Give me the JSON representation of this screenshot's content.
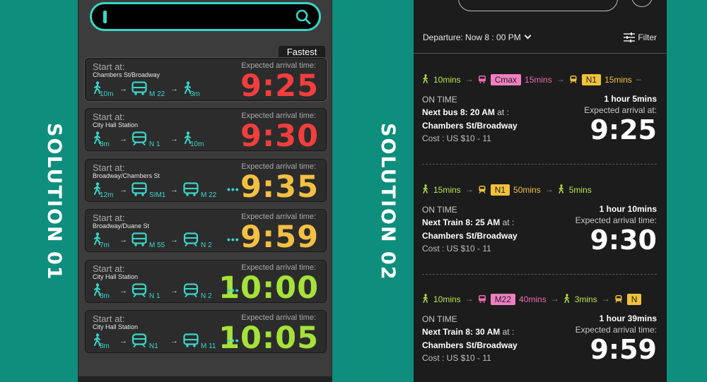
{
  "labels": {
    "solution1": "SOLUTION 01",
    "solution2": "SOLUTION 02"
  },
  "colors": {
    "background": "#0e8e7c",
    "accent": "#3ad6c8",
    "red": "#f23e3e",
    "yellow": "#f4c043",
    "green": "#a6e23a",
    "pink": "#f27ec2",
    "tag_yellow": "#f2c23a"
  },
  "solution1": {
    "search": {
      "icon": "search-icon"
    },
    "fastest_label": "Fastest",
    "cards": [
      {
        "start_label": "Start at:",
        "location": "Chambers St/Broadway",
        "expected_label": "Expected arrival time:",
        "time": "9:25",
        "color": "#f23e3e",
        "route": [
          {
            "type": "walk",
            "label": "10m"
          },
          {
            "type": "bus",
            "label": "M 22"
          },
          {
            "type": "walk",
            "label": "3m"
          }
        ],
        "more": ""
      },
      {
        "start_label": "Start at:",
        "location": "City Hall Station",
        "expected_label": "Expected arrival time:",
        "time": "9:30",
        "color": "#f23e3e",
        "route": [
          {
            "type": "walk",
            "label": "8m"
          },
          {
            "type": "train",
            "label": "N 1"
          },
          {
            "type": "walk",
            "label": "10m"
          }
        ],
        "more": ""
      },
      {
        "start_label": "Start at:",
        "location": "Broadway/Chambers St",
        "expected_label": "Expected arrival time:",
        "time": "9:35",
        "color": "#f4c043",
        "route": [
          {
            "type": "walk",
            "label": "12m"
          },
          {
            "type": "bus",
            "label": "SIM1"
          },
          {
            "type": "bus",
            "label": "M 22"
          }
        ],
        "more": "•••"
      },
      {
        "start_label": "Start at:",
        "location": "Broadway/Duane St",
        "expected_label": "Expected arrival time:",
        "time": "9:59",
        "color": "#f4c043",
        "route": [
          {
            "type": "walk",
            "label": "7m"
          },
          {
            "type": "bus",
            "label": "M 55"
          },
          {
            "type": "train",
            "label": "N 2"
          }
        ],
        "more": "•••"
      },
      {
        "start_label": "Start at:",
        "location": "City Hall Station",
        "expected_label": "Expected arrival time:",
        "time": "10:00",
        "color": "#a6e23a",
        "route": [
          {
            "type": "walk",
            "label": "8m"
          },
          {
            "type": "train",
            "label": "N 1"
          },
          {
            "type": "train",
            "label": "N 2"
          }
        ],
        "more": "•••"
      },
      {
        "start_label": "Start at:",
        "location": "City Hall Station",
        "expected_label": "Expected arrival time:",
        "time": "10:05",
        "color": "#a6e23a",
        "route": [
          {
            "type": "walk",
            "label": "8m"
          },
          {
            "type": "train",
            "label": "N1"
          },
          {
            "type": "bus",
            "label": "M 11"
          }
        ],
        "more": "•••"
      }
    ]
  },
  "solution2": {
    "departure_label": "Departure: Now 8 : 00 PM",
    "filter_label": "Filter",
    "trips": [
      {
        "route": [
          {
            "icon": "walk",
            "text": "10mins",
            "color": "green"
          },
          {
            "icon": "bus",
            "tag": "Cmax",
            "tagcolor": "pink",
            "text": "15mins",
            "color": "pink"
          },
          {
            "icon": "train",
            "tag": "N1",
            "tagcolor": "yellow",
            "text": "15mins",
            "color": "yellow"
          }
        ],
        "trailing": "–",
        "status": "ON TIME",
        "next_prefix": "Next bus 8: 20 AM",
        "at": " at :",
        "station": "Chambers St/Broadway",
        "cost": "Cost : US $10 - 11",
        "duration": "1 hour 5mins",
        "expected_label": "Expected arrival at:",
        "time": "9:25"
      },
      {
        "route": [
          {
            "icon": "walk",
            "text": "15mins",
            "color": "green"
          },
          {
            "icon": "train",
            "tag": "N1",
            "tagcolor": "yellow",
            "text": "50mins",
            "color": "yellow"
          },
          {
            "icon": "walk",
            "text": "5mins",
            "color": "green"
          }
        ],
        "trailing": "",
        "status": "ON TIME",
        "next_prefix": "Next Train 8: 25 AM",
        "at": " at :",
        "station": "Chambers St/Broadway",
        "cost": "Cost : US $10 - 11",
        "duration": "1 hour 10mins",
        "expected_label": "Expected arrival time:",
        "time": "9:30"
      },
      {
        "route": [
          {
            "icon": "walk",
            "text": "10mins",
            "color": "green"
          },
          {
            "icon": "bus",
            "tag": "M22",
            "tagcolor": "pink",
            "text": "40mins",
            "color": "pink"
          },
          {
            "icon": "walk",
            "text": "3mins",
            "color": "green"
          },
          {
            "icon": "train",
            "tag": "N",
            "tagcolor": "yellow",
            "text": "",
            "color": "yellow"
          }
        ],
        "trailing": "",
        "status": "ON TIME",
        "next_prefix": "Next Train 8: 30 AM",
        "at": " at :",
        "station": "Chambers St/Broadway",
        "cost": "Cost : US $10 - 11",
        "duration": "1 hour 39mins",
        "expected_label": "Expected arrival time:",
        "time": "9:59"
      }
    ]
  }
}
